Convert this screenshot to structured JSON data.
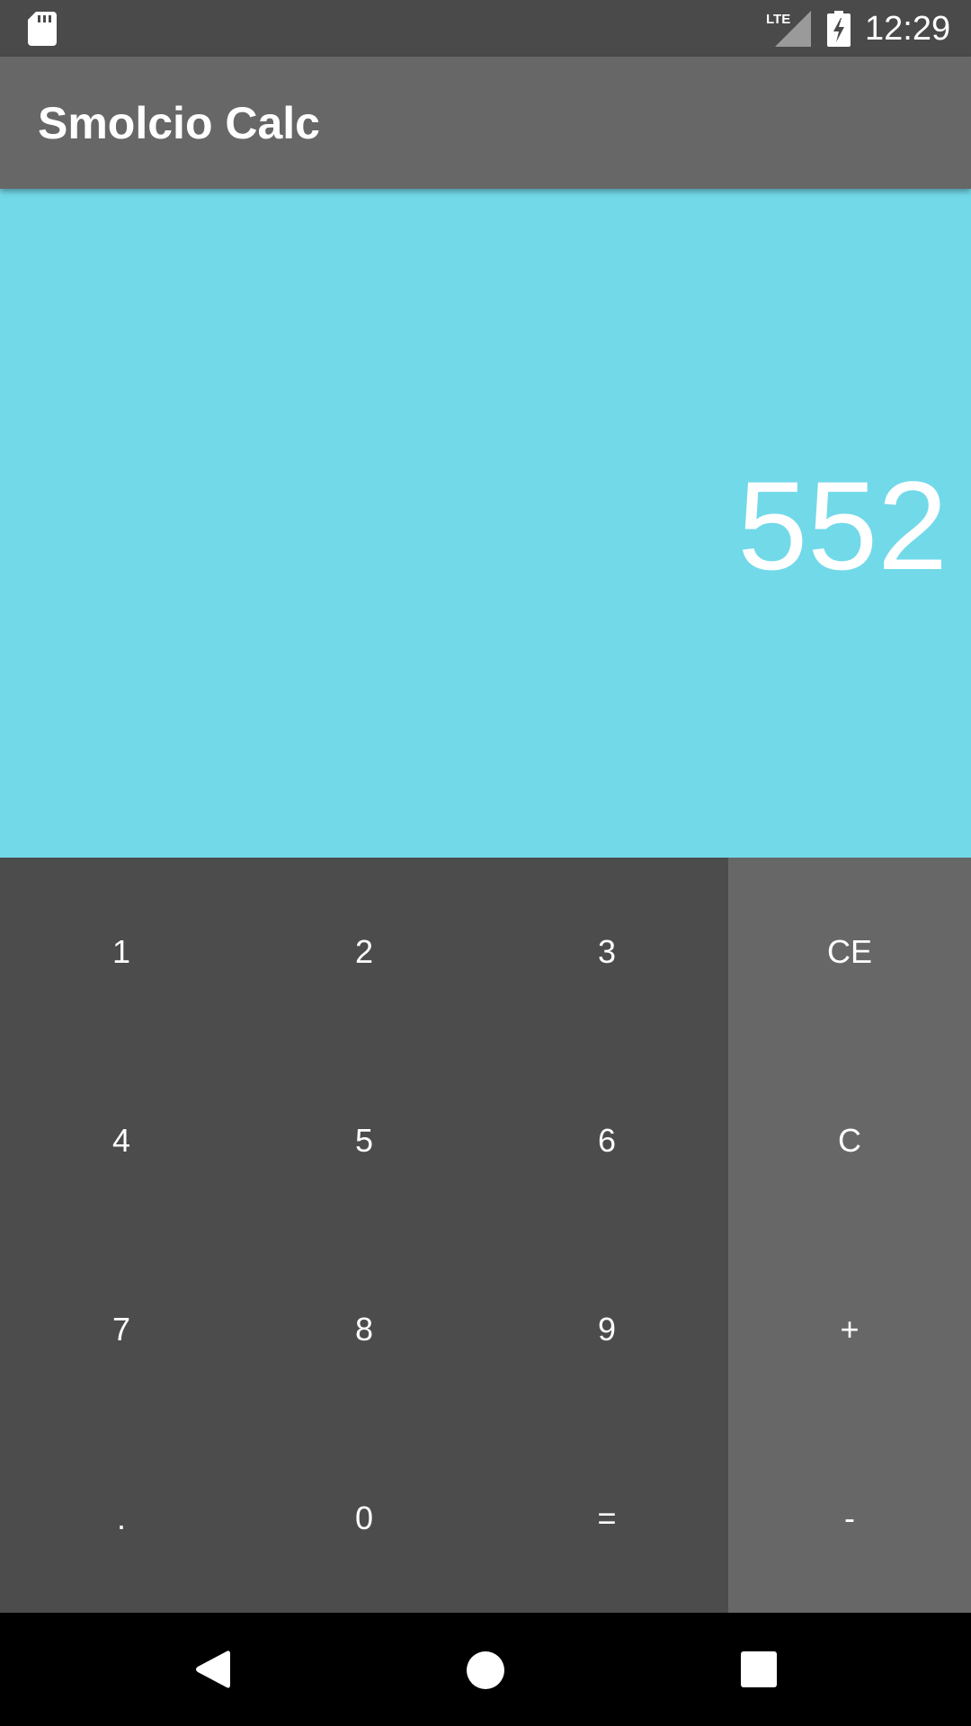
{
  "status_bar": {
    "time": "12:29",
    "network": "LTE",
    "icons": [
      "sd-card-icon",
      "lte-signal-icon",
      "battery-charging-icon"
    ]
  },
  "app_bar": {
    "title": "Smolcio Calc"
  },
  "display": {
    "value": "552"
  },
  "keypad": {
    "rows": [
      [
        "1",
        "2",
        "3",
        "CE"
      ],
      [
        "4",
        "5",
        "6",
        "C"
      ],
      [
        "7",
        "8",
        "9",
        "+"
      ],
      [
        ".",
        "0",
        "=",
        "-"
      ]
    ]
  },
  "nav_bar": {
    "icons": [
      "back-icon",
      "home-icon",
      "recents-icon"
    ]
  },
  "colors": {
    "status_bar": "#4a4a4a",
    "app_bar": "#676767",
    "display": "#72d9e9",
    "keypad": "#4c4c4c",
    "ops_column": "#676767"
  }
}
